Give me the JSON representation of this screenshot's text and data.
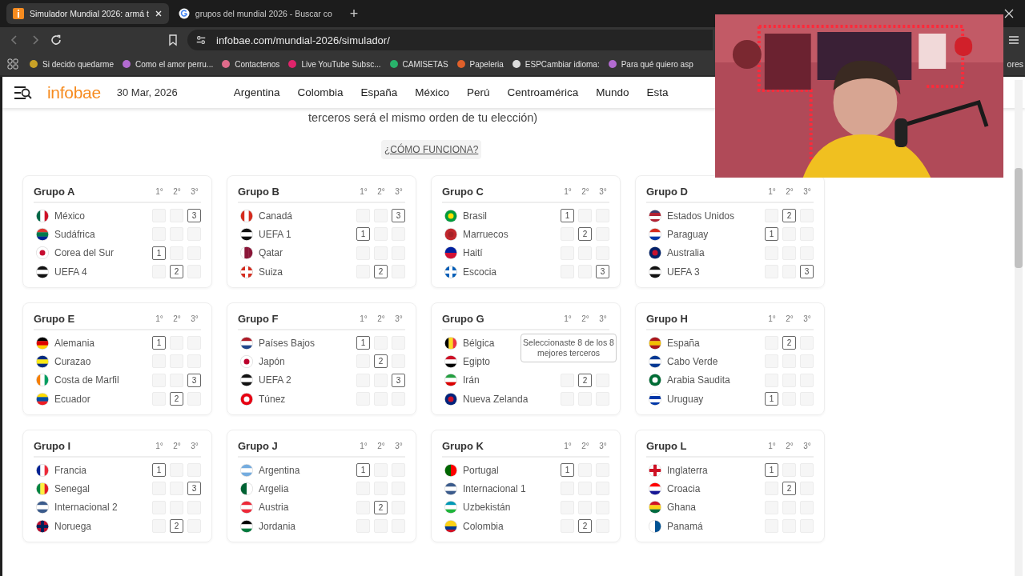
{
  "browser": {
    "tabs": [
      {
        "title": "Simulador Mundial 2026: armá t",
        "selected": true,
        "kind": "site"
      },
      {
        "title": "grupos del mundial 2026 - Buscar co",
        "selected": false,
        "kind": "search"
      }
    ],
    "new_tab": "+",
    "url": "infobae.com/mundial-2026/simulador/",
    "bookmarks": [
      "Si decido quedarme",
      "Como el amor perru...",
      "Contactenos",
      "Live YouTube Subsc...",
      "CAMISETAS",
      "Papeleria",
      "ESPCambiar idioma:",
      "Para qué quiero asp"
    ],
    "other_bookmarks": "ores"
  },
  "site": {
    "logo": "infobae",
    "date": "30 Mar, 2026",
    "nav": [
      "Argentina",
      "Colombia",
      "España",
      "México",
      "Perú",
      "Centroamérica",
      "Mundo",
      "Esta"
    ]
  },
  "intro": "terceros será el mismo orden de tu elección)",
  "help_link": "¿CÓMO FUNCIONA?",
  "groups": [
    {
      "title": "Grupo A",
      "positions": [
        "1°",
        "2°",
        "3°"
      ],
      "teams": [
        {
          "name": "México",
          "flag": {
            "kind": "vertical",
            "stripes": [
              {
                "color": "#006847"
              },
              {
                "color": "#ffffff"
              },
              {
                "color": "#ce1126"
              }
            ]
          },
          "slots": [
            {
              "selected": false
            },
            {
              "selected": false
            },
            {
              "selected": true,
              "label": "3"
            }
          ]
        },
        {
          "name": "Sudáfrica",
          "flag": {
            "kind": "horizontal",
            "stripes": [
              {
                "color": "#de3831"
              },
              {
                "color": "#007a4d"
              },
              {
                "color": "#002395"
              }
            ]
          },
          "slots": [
            {
              "selected": false
            },
            {
              "selected": false
            },
            {
              "selected": false
            }
          ]
        },
        {
          "name": "Corea del Sur",
          "flag": {
            "kind": "dot",
            "stripes": [
              {
                "color": "#ffffff"
              },
              {
                "color": "#c60c30"
              }
            ]
          },
          "slots": [
            {
              "selected": true,
              "label": "1"
            },
            {
              "selected": false
            },
            {
              "selected": false
            }
          ]
        },
        {
          "name": "UEFA 4",
          "flag": {
            "kind": "horizontal",
            "stripes": [
              {
                "color": "#111111"
              },
              {
                "color": "#ffffff"
              },
              {
                "color": "#111111"
              }
            ]
          },
          "slots": [
            {
              "selected": false
            },
            {
              "selected": true,
              "label": "2"
            },
            {
              "selected": false
            }
          ]
        }
      ]
    },
    {
      "title": "Grupo B",
      "positions": [
        "1°",
        "2°",
        "3°"
      ],
      "teams": [
        {
          "name": "Canadá",
          "flag": {
            "kind": "vertical",
            "stripes": [
              {
                "color": "#d52b1e"
              },
              {
                "color": "#ffffff"
              },
              {
                "color": "#d52b1e"
              }
            ]
          },
          "slots": [
            {
              "selected": false
            },
            {
              "selected": false
            },
            {
              "selected": true,
              "label": "3"
            }
          ]
        },
        {
          "name": "UEFA 1",
          "flag": {
            "kind": "horizontal",
            "stripes": [
              {
                "color": "#111111"
              },
              {
                "color": "#ffffff"
              },
              {
                "color": "#111111"
              }
            ]
          },
          "slots": [
            {
              "selected": true,
              "label": "1"
            },
            {
              "selected": false
            },
            {
              "selected": false
            }
          ]
        },
        {
          "name": "Qatar",
          "flag": {
            "kind": "vertical",
            "stripes": [
              {
                "color": "#ffffff"
              },
              {
                "color": "#8a1538"
              },
              {
                "color": "#8a1538"
              }
            ]
          },
          "slots": [
            {
              "selected": false
            },
            {
              "selected": false
            },
            {
              "selected": false
            }
          ]
        },
        {
          "name": "Suiza",
          "flag": {
            "kind": "cross",
            "stripes": [
              {
                "color": "#d52b1e"
              },
              {
                "color": "#ffffff"
              }
            ]
          },
          "slots": [
            {
              "selected": false
            },
            {
              "selected": true,
              "label": "2"
            },
            {
              "selected": false
            }
          ]
        }
      ]
    },
    {
      "title": "Grupo C",
      "positions": [
        "1°",
        "2°",
        "3°"
      ],
      "teams": [
        {
          "name": "Brasil",
          "flag": {
            "kind": "dot",
            "stripes": [
              {
                "color": "#009c3b"
              },
              {
                "color": "#ffdf00"
              }
            ]
          },
          "slots": [
            {
              "selected": true,
              "label": "1"
            },
            {
              "selected": false
            },
            {
              "selected": false
            }
          ]
        },
        {
          "name": "Marruecos",
          "flag": {
            "kind": "dot",
            "stripes": [
              {
                "color": "#c1272d"
              },
              {
                "color": "#a52228"
              }
            ]
          },
          "slots": [
            {
              "selected": false
            },
            {
              "selected": true,
              "label": "2"
            },
            {
              "selected": false
            }
          ]
        },
        {
          "name": "Haití",
          "flag": {
            "kind": "horizontal",
            "stripes": [
              {
                "color": "#00209f"
              },
              {
                "color": "#d21034"
              }
            ]
          },
          "slots": [
            {
              "selected": false
            },
            {
              "selected": false
            },
            {
              "selected": false
            }
          ]
        },
        {
          "name": "Escocia",
          "flag": {
            "kind": "cross",
            "stripes": [
              {
                "color": "#005eb8"
              },
              {
                "color": "#ffffff"
              }
            ]
          },
          "slots": [
            {
              "selected": false
            },
            {
              "selected": false
            },
            {
              "selected": true,
              "label": "3"
            }
          ]
        }
      ]
    },
    {
      "title": "Grupo D",
      "positions": [
        "1°",
        "2°",
        "3°"
      ],
      "teams": [
        {
          "name": "Estados Unidos",
          "flag": {
            "kind": "horizontal",
            "stripes": [
              {
                "color": "#3c3b6e"
              },
              {
                "color": "#b22234"
              },
              {
                "color": "#ffffff"
              },
              {
                "color": "#b22234"
              }
            ]
          },
          "slots": [
            {
              "selected": false
            },
            {
              "selected": true,
              "label": "2"
            },
            {
              "selected": false
            }
          ]
        },
        {
          "name": "Paraguay",
          "flag": {
            "kind": "horizontal",
            "stripes": [
              {
                "color": "#d52b1e"
              },
              {
                "color": "#ffffff"
              },
              {
                "color": "#0038a8"
              }
            ]
          },
          "slots": [
            {
              "selected": true,
              "label": "1"
            },
            {
              "selected": false
            },
            {
              "selected": false
            }
          ]
        },
        {
          "name": "Australia",
          "flag": {
            "kind": "dot",
            "stripes": [
              {
                "color": "#012169"
              },
              {
                "color": "#c8102e"
              }
            ]
          },
          "slots": [
            {
              "selected": false
            },
            {
              "selected": false
            },
            {
              "selected": false
            }
          ]
        },
        {
          "name": "UEFA 3",
          "flag": {
            "kind": "horizontal",
            "stripes": [
              {
                "color": "#111111"
              },
              {
                "color": "#ffffff"
              },
              {
                "color": "#111111"
              }
            ]
          },
          "slots": [
            {
              "selected": false
            },
            {
              "selected": false
            },
            {
              "selected": true,
              "label": "3"
            }
          ]
        }
      ]
    },
    {
      "title": "Grupo E",
      "positions": [
        "1°",
        "2°",
        "3°"
      ],
      "teams": [
        {
          "name": "Alemania",
          "flag": {
            "kind": "horizontal",
            "stripes": [
              {
                "color": "#000000"
              },
              {
                "color": "#dd0000"
              },
              {
                "color": "#ffce00"
              }
            ]
          },
          "slots": [
            {
              "selected": true,
              "label": "1"
            },
            {
              "selected": false
            },
            {
              "selected": false
            }
          ]
        },
        {
          "name": "Curazao",
          "flag": {
            "kind": "horizontal",
            "stripes": [
              {
                "color": "#002b7f"
              },
              {
                "color": "#f9e814"
              },
              {
                "color": "#002b7f"
              }
            ]
          },
          "slots": [
            {
              "selected": false
            },
            {
              "selected": false
            },
            {
              "selected": false
            }
          ]
        },
        {
          "name": "Costa de Marfil",
          "flag": {
            "kind": "vertical",
            "stripes": [
              {
                "color": "#f77f00"
              },
              {
                "color": "#ffffff"
              },
              {
                "color": "#009e60"
              }
            ]
          },
          "slots": [
            {
              "selected": false
            },
            {
              "selected": false
            },
            {
              "selected": true,
              "label": "3"
            }
          ]
        },
        {
          "name": "Ecuador",
          "flag": {
            "kind": "horizontal",
            "stripes": [
              {
                "color": "#ffdd00"
              },
              {
                "color": "#034ea2"
              },
              {
                "color": "#ed1c24"
              }
            ]
          },
          "slots": [
            {
              "selected": false
            },
            {
              "selected": true,
              "label": "2"
            },
            {
              "selected": false
            }
          ]
        }
      ]
    },
    {
      "title": "Grupo F",
      "positions": [
        "1°",
        "2°",
        "3°"
      ],
      "teams": [
        {
          "name": "Países Bajos",
          "flag": {
            "kind": "horizontal",
            "stripes": [
              {
                "color": "#ae1c28"
              },
              {
                "color": "#ffffff"
              },
              {
                "color": "#21468b"
              }
            ]
          },
          "slots": [
            {
              "selected": true,
              "label": "1"
            },
            {
              "selected": false
            },
            {
              "selected": false
            }
          ]
        },
        {
          "name": "Japón",
          "flag": {
            "kind": "dot",
            "stripes": [
              {
                "color": "#ffffff"
              },
              {
                "color": "#bc002d"
              }
            ]
          },
          "slots": [
            {
              "selected": false
            },
            {
              "selected": true,
              "label": "2"
            },
            {
              "selected": false
            }
          ]
        },
        {
          "name": "UEFA 2",
          "flag": {
            "kind": "horizontal",
            "stripes": [
              {
                "color": "#111111"
              },
              {
                "color": "#ffffff"
              },
              {
                "color": "#111111"
              }
            ]
          },
          "slots": [
            {
              "selected": false
            },
            {
              "selected": false
            },
            {
              "selected": true,
              "label": "3"
            }
          ]
        },
        {
          "name": "Túnez",
          "flag": {
            "kind": "dot",
            "stripes": [
              {
                "color": "#e70013"
              },
              {
                "color": "#ffffff"
              }
            ]
          },
          "slots": [
            {
              "selected": false
            },
            {
              "selected": false
            },
            {
              "selected": false
            }
          ]
        }
      ]
    },
    {
      "title": "Grupo G",
      "positions": [
        "1°",
        "2°",
        "3°"
      ],
      "teams": [
        {
          "name": "Bélgica",
          "flag": {
            "kind": "vertical",
            "stripes": [
              {
                "color": "#000000"
              },
              {
                "color": "#fdda24"
              },
              {
                "color": "#ef3340"
              }
            ]
          }
        },
        {
          "name": "Egipto",
          "flag": {
            "kind": "horizontal",
            "stripes": [
              {
                "color": "#ce1126"
              },
              {
                "color": "#ffffff"
              },
              {
                "color": "#000000"
              }
            ]
          }
        },
        {
          "name": "Irán",
          "flag": {
            "kind": "horizontal",
            "stripes": [
              {
                "color": "#239f40"
              },
              {
                "color": "#ffffff"
              },
              {
                "color": "#da0000"
              }
            ]
          },
          "slots": [
            {
              "selected": false
            },
            {
              "selected": true,
              "label": "2"
            },
            {
              "selected": false
            }
          ]
        },
        {
          "name": "Nueva Zelanda",
          "flag": {
            "kind": "dot",
            "stripes": [
              {
                "color": "#00247d"
              },
              {
                "color": "#cc142b"
              }
            ]
          },
          "slots": [
            {
              "selected": false
            },
            {
              "selected": false
            },
            {
              "selected": false
            }
          ]
        }
      ]
    },
    {
      "title": "Grupo H",
      "positions": [
        "1°",
        "2°",
        "3°"
      ],
      "teams": [
        {
          "name": "España",
          "flag": {
            "kind": "horizontal",
            "stripes": [
              {
                "color": "#aa151b"
              },
              {
                "color": "#f1bf00"
              },
              {
                "color": "#aa151b"
              }
            ]
          },
          "slots": [
            {
              "selected": false
            },
            {
              "selected": true,
              "label": "2"
            },
            {
              "selected": false
            }
          ]
        },
        {
          "name": "Cabo Verde",
          "flag": {
            "kind": "horizontal",
            "stripes": [
              {
                "color": "#003893"
              },
              {
                "color": "#ffffff"
              },
              {
                "color": "#003893"
              }
            ]
          },
          "slots": [
            {
              "selected": false
            },
            {
              "selected": false
            },
            {
              "selected": false
            }
          ]
        },
        {
          "name": "Arabia Saudita",
          "flag": {
            "kind": "dot",
            "stripes": [
              {
                "color": "#006c35"
              },
              {
                "color": "#ffffff"
              }
            ]
          },
          "slots": [
            {
              "selected": false
            },
            {
              "selected": false
            },
            {
              "selected": false
            }
          ]
        },
        {
          "name": "Uruguay",
          "flag": {
            "kind": "horizontal",
            "stripes": [
              {
                "color": "#ffffff"
              },
              {
                "color": "#0038a8"
              },
              {
                "color": "#ffffff"
              },
              {
                "color": "#0038a8"
              }
            ]
          },
          "slots": [
            {
              "selected": true,
              "label": "1"
            },
            {
              "selected": false
            },
            {
              "selected": false
            }
          ]
        }
      ]
    },
    {
      "title": "Grupo I",
      "positions": [
        "1°",
        "2°",
        "3°"
      ],
      "teams": [
        {
          "name": "Francia",
          "flag": {
            "kind": "vertical",
            "stripes": [
              {
                "color": "#002395"
              },
              {
                "color": "#ffffff"
              },
              {
                "color": "#ed2939"
              }
            ]
          },
          "slots": [
            {
              "selected": true,
              "label": "1"
            },
            {
              "selected": false
            },
            {
              "selected": false
            }
          ]
        },
        {
          "name": "Senegal",
          "flag": {
            "kind": "vertical",
            "stripes": [
              {
                "color": "#00853f"
              },
              {
                "color": "#fdef42"
              },
              {
                "color": "#e31b23"
              }
            ]
          },
          "slots": [
            {
              "selected": false
            },
            {
              "selected": false
            },
            {
              "selected": true,
              "label": "3"
            }
          ]
        },
        {
          "name": "Internacional 2",
          "flag": {
            "kind": "horizontal",
            "stripes": [
              {
                "color": "#3b5b8c"
              },
              {
                "color": "#ffffff"
              },
              {
                "color": "#3b5b8c"
              }
            ]
          },
          "slots": [
            {
              "selected": false
            },
            {
              "selected": false
            },
            {
              "selected": false
            }
          ]
        },
        {
          "name": "Noruega",
          "flag": {
            "kind": "cross",
            "stripes": [
              {
                "color": "#ba0c2f"
              },
              {
                "color": "#00205b"
              }
            ]
          },
          "slots": [
            {
              "selected": false
            },
            {
              "selected": true,
              "label": "2"
            },
            {
              "selected": false
            }
          ]
        }
      ]
    },
    {
      "title": "Grupo J",
      "positions": [
        "1°",
        "2°",
        "3°"
      ],
      "teams": [
        {
          "name": "Argentina",
          "flag": {
            "kind": "horizontal",
            "stripes": [
              {
                "color": "#74acdf"
              },
              {
                "color": "#ffffff"
              },
              {
                "color": "#74acdf"
              }
            ]
          },
          "slots": [
            {
              "selected": true,
              "label": "1"
            },
            {
              "selected": false
            },
            {
              "selected": false
            }
          ]
        },
        {
          "name": "Argelia",
          "flag": {
            "kind": "vertical",
            "stripes": [
              {
                "color": "#006233"
              },
              {
                "color": "#ffffff"
              }
            ]
          },
          "slots": [
            {
              "selected": false
            },
            {
              "selected": false
            },
            {
              "selected": false
            }
          ]
        },
        {
          "name": "Austria",
          "flag": {
            "kind": "horizontal",
            "stripes": [
              {
                "color": "#ed2939"
              },
              {
                "color": "#ffffff"
              },
              {
                "color": "#ed2939"
              }
            ]
          },
          "slots": [
            {
              "selected": false
            },
            {
              "selected": true,
              "label": "2"
            },
            {
              "selected": false
            }
          ]
        },
        {
          "name": "Jordania",
          "flag": {
            "kind": "horizontal",
            "stripes": [
              {
                "color": "#000000"
              },
              {
                "color": "#ffffff"
              },
              {
                "color": "#007a3d"
              }
            ]
          },
          "slots": [
            {
              "selected": false
            },
            {
              "selected": false
            },
            {
              "selected": false
            }
          ]
        }
      ]
    },
    {
      "title": "Grupo K",
      "positions": [
        "1°",
        "2°",
        "3°"
      ],
      "teams": [
        {
          "name": "Portugal",
          "flag": {
            "kind": "vertical",
            "stripes": [
              {
                "color": "#006600"
              },
              {
                "color": "#ff0000"
              }
            ]
          },
          "slots": [
            {
              "selected": true,
              "label": "1"
            },
            {
              "selected": false
            },
            {
              "selected": false
            }
          ]
        },
        {
          "name": "Internacional 1",
          "flag": {
            "kind": "horizontal",
            "stripes": [
              {
                "color": "#3b5b8c"
              },
              {
                "color": "#ffffff"
              },
              {
                "color": "#3b5b8c"
              }
            ]
          },
          "slots": [
            {
              "selected": false
            },
            {
              "selected": false
            },
            {
              "selected": false
            }
          ]
        },
        {
          "name": "Uzbekistán",
          "flag": {
            "kind": "horizontal",
            "stripes": [
              {
                "color": "#0099b5"
              },
              {
                "color": "#ffffff"
              },
              {
                "color": "#1eb53a"
              }
            ]
          },
          "slots": [
            {
              "selected": false
            },
            {
              "selected": false
            },
            {
              "selected": false
            }
          ]
        },
        {
          "name": "Colombia",
          "flag": {
            "kind": "horizontal",
            "stripes": [
              {
                "color": "#fcd116"
              },
              {
                "color": "#fcd116"
              },
              {
                "color": "#003893"
              },
              {
                "color": "#ce1126"
              }
            ]
          },
          "slots": [
            {
              "selected": false
            },
            {
              "selected": true,
              "label": "2"
            },
            {
              "selected": false
            }
          ]
        }
      ]
    },
    {
      "title": "Grupo L",
      "positions": [
        "1°",
        "2°",
        "3°"
      ],
      "teams": [
        {
          "name": "Inglaterra",
          "flag": {
            "kind": "cross",
            "stripes": [
              {
                "color": "#ffffff"
              },
              {
                "color": "#ce1124"
              }
            ]
          },
          "slots": [
            {
              "selected": true,
              "label": "1"
            },
            {
              "selected": false
            },
            {
              "selected": false
            }
          ]
        },
        {
          "name": "Croacia",
          "flag": {
            "kind": "horizontal",
            "stripes": [
              {
                "color": "#ff0000"
              },
              {
                "color": "#ffffff"
              },
              {
                "color": "#171796"
              }
            ]
          },
          "slots": [
            {
              "selected": false
            },
            {
              "selected": true,
              "label": "2"
            },
            {
              "selected": false
            }
          ]
        },
        {
          "name": "Ghana",
          "flag": {
            "kind": "horizontal",
            "stripes": [
              {
                "color": "#ce1126"
              },
              {
                "color": "#fcd116"
              },
              {
                "color": "#006b3f"
              }
            ]
          },
          "slots": [
            {
              "selected": false
            },
            {
              "selected": false
            },
            {
              "selected": false
            }
          ]
        },
        {
          "name": "Panamá",
          "flag": {
            "kind": "vertical",
            "stripes": [
              {
                "color": "#ffffff"
              },
              {
                "color": "#005293"
              }
            ]
          },
          "slots": [
            {
              "selected": false
            },
            {
              "selected": false
            },
            {
              "selected": false
            }
          ]
        }
      ]
    }
  ],
  "tooltip": "Seleccionaste 8 de los 8 mejores terceros"
}
